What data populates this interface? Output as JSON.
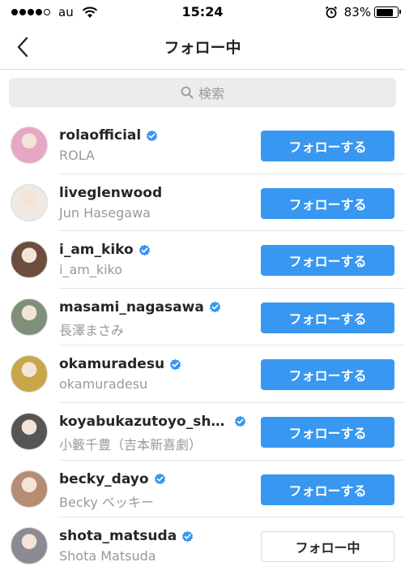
{
  "status_bar": {
    "carrier": "au",
    "time": "15:24",
    "battery_percent": "83%",
    "battery_level": 0.83,
    "signal_bars_filled": 4,
    "signal_bars_total": 5
  },
  "nav": {
    "title": "フォロー中",
    "back_icon": "chevron-left-icon"
  },
  "search": {
    "placeholder": "検索",
    "icon": "search-icon"
  },
  "colors": {
    "accent": "#3897f0",
    "verified": "#3897f0",
    "secondary_text": "#999999"
  },
  "rows": [
    {
      "username": "rolaofficial",
      "full_name": "ROLA",
      "verified": true,
      "button": "フォローする",
      "avatar_color": "#e7a7c4"
    },
    {
      "username": "liveglenwood",
      "full_name": "Jun Hasegawa",
      "verified": false,
      "button": "フォローする",
      "avatar_color": "#efe9e2"
    },
    {
      "username": "i_am_kiko",
      "full_name": "i_am_kiko",
      "verified": true,
      "button": "フォローする",
      "avatar_color": "#6b4e3d"
    },
    {
      "username": "masami_nagasawa",
      "full_name": "長澤まさみ",
      "verified": true,
      "button": "フォローする",
      "avatar_color": "#7e8f7a"
    },
    {
      "username": "okamuradesu",
      "full_name": "okamuradesu",
      "verified": true,
      "button": "フォローする",
      "avatar_color": "#c9a64a"
    },
    {
      "username": "koyabukazutoyo_shin...",
      "full_name": "小籔千豊（吉本新喜劇）",
      "verified": true,
      "button": "フォローする",
      "avatar_color": "#555555"
    },
    {
      "username": "becky_dayo",
      "full_name": "Becky ベッキー",
      "verified": true,
      "button": "フォローする",
      "avatar_color": "#b58d72"
    },
    {
      "username": "shota_matsuda",
      "full_name": "Shota Matsuda",
      "verified": true,
      "button": "フォロー中",
      "avatar_color": "#8c8a92"
    }
  ]
}
